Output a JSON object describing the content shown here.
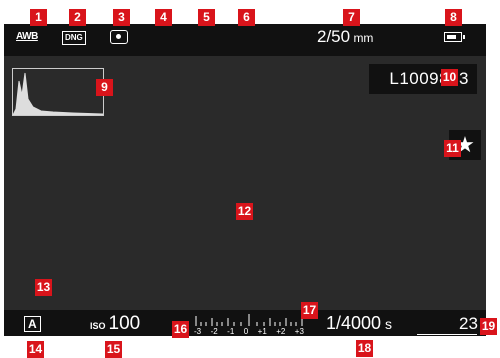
{
  "top": {
    "awb": "AWB",
    "format": "DNG",
    "focal_value": "2/50",
    "focal_unit": "mm"
  },
  "image": {
    "filename": "L1009803"
  },
  "bottom": {
    "mode": "A",
    "iso_label": "ISO",
    "iso_value": "100",
    "scale_labels": [
      "-3",
      "-2",
      "-1",
      "0",
      "+1",
      "+2",
      "+3"
    ],
    "shutter_value": "1/4000",
    "shutter_unit": "s",
    "shots_remaining": "23"
  },
  "callouts": [
    "1",
    "2",
    "3",
    "4",
    "5",
    "6",
    "7",
    "8",
    "9",
    "10",
    "11",
    "12",
    "13",
    "14",
    "15",
    "16",
    "17",
    "18",
    "19"
  ],
  "colors": {
    "callout": "#d9141b",
    "screen": "#2a2a2a",
    "bars": "#111111"
  },
  "icons": {
    "metering": "spot-metering-icon",
    "battery": "battery-icon",
    "star": "star-icon",
    "histogram": "histogram-icon"
  }
}
